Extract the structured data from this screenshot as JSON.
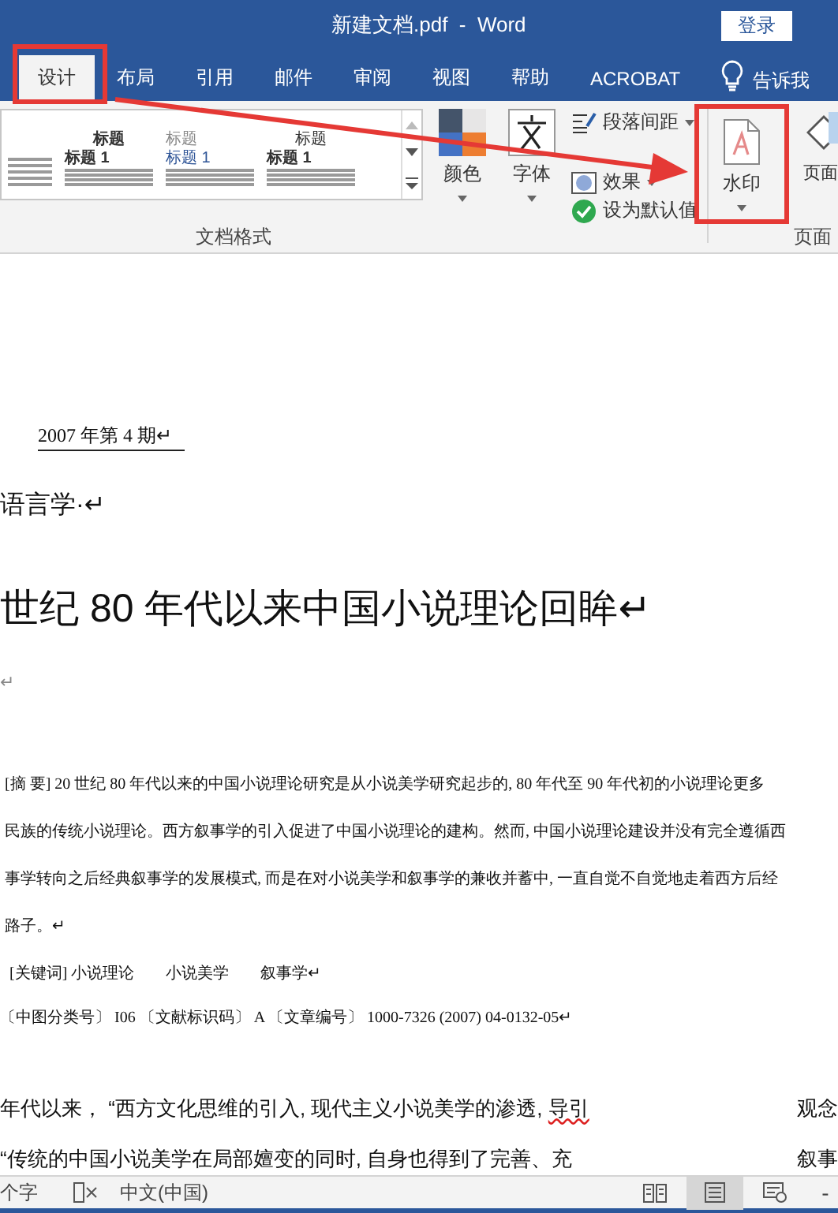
{
  "window": {
    "title": "新建文档.pdf  -  Word",
    "login_button": "登录"
  },
  "tabs": [
    {
      "label": "设计",
      "selected": true
    },
    {
      "label": "布局",
      "selected": false
    },
    {
      "label": "引用",
      "selected": false
    },
    {
      "label": "邮件",
      "selected": false
    },
    {
      "label": "审阅",
      "selected": false
    },
    {
      "label": "视图",
      "selected": false
    },
    {
      "label": "帮助",
      "selected": false
    },
    {
      "label": "ACROBAT",
      "selected": false
    }
  ],
  "tell_me": "告诉我",
  "ribbon": {
    "style_gallery": [
      {
        "heading": "标题",
        "subheading": "标题 1"
      },
      {
        "heading": "标题",
        "subheading": "标题 1"
      },
      {
        "heading": "标题",
        "subheading": "标题 1"
      }
    ],
    "colors_button": "颜色",
    "fonts_button": "字体",
    "small_buttons": [
      {
        "kind": "spacing",
        "label": "段落间距",
        "dropdown": true
      },
      {
        "kind": "effects",
        "label": "效果",
        "dropdown": true
      },
      {
        "kind": "default",
        "label": "设为默认值",
        "dropdown": false
      }
    ],
    "group_label": "文档格式",
    "watermark_button": "水印",
    "page_color_button": "页面",
    "page_group_label": "页面"
  },
  "document": {
    "lines": [
      {
        "kind": "issue",
        "text": "2007 年第 4 期↵"
      },
      {
        "kind": "section",
        "text": "语言学·↵"
      },
      {
        "kind": "title",
        "text": "世纪 80 年代以来中国小说理论回眸↵"
      },
      {
        "kind": "blank",
        "text": "↵"
      },
      {
        "kind": "abstract",
        "text": "[摘 要] 20 世纪 80 年代以来的中国小说理论研究是从小说美学研究起步的, 80 年代至 90 年代初的小说理论更多"
      },
      {
        "kind": "abstract",
        "text": "民族的传统小说理论。西方叙事学的引入促进了中国小说理论的建构。然而, 中国小说理论建设并没有完全遵循西"
      },
      {
        "kind": "abstract",
        "text": "事学转向之后经典叙事学的发展模式, 而是在对小说美学和叙事学的兼收并蓄中, 一直自觉不自觉地走着西方后经"
      },
      {
        "kind": "abstract",
        "text": "路子。↵"
      },
      {
        "kind": "keywords",
        "text": "[关键词] 小说理论　　小说美学　　叙事学↵"
      },
      {
        "kind": "classification",
        "text": "〔中图分类号〕 I06 〔文献标识码〕 A 〔文章编号〕 1000-7326 (2007) 04-0132-05↵"
      },
      {
        "kind": "body",
        "segments": [
          {
            "text": "年代以来， “西方文化思维的引入, 现代主义小说美学的渗透, ",
            "misspelled": false
          },
          {
            "text": "导引",
            "misspelled": true
          }
        ],
        "tail": "观念"
      },
      {
        "kind": "body",
        "segments": [
          {
            "text": "“传统的中国小说美学在局部嬗变的同时, 自身也得到了完善、充",
            "misspelled": false
          }
        ],
        "tail": "叙事"
      }
    ]
  },
  "status_bar": {
    "word_count": "个字",
    "language": "中文(中国)",
    "views": [
      {
        "kind": "read",
        "selected": false
      },
      {
        "kind": "print",
        "selected": true
      },
      {
        "kind": "web",
        "selected": false
      }
    ],
    "zoom_out": "-"
  }
}
